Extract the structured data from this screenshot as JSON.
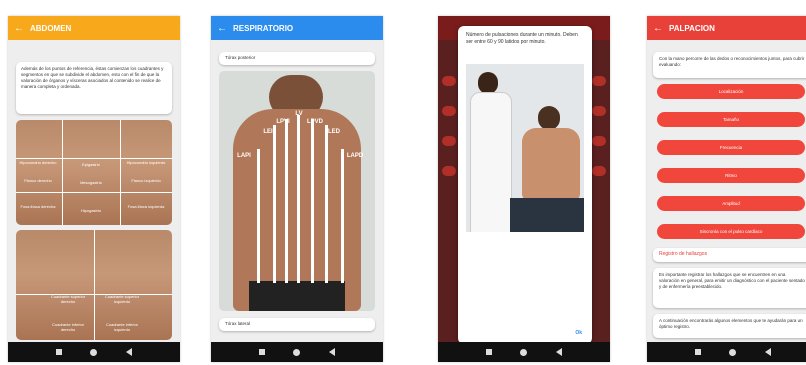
{
  "colors": {
    "orange": "#f7a81b",
    "blue": "#2b8cee",
    "red": "#e8413a",
    "dark_red": "#8b1a1a"
  },
  "screen1": {
    "title": "ABDOMEN",
    "intro": "Además de los puntos de referencia, éstas comienzan los cuadrantes y segmentos en que se subdivide el abdomen, esto con el fin de que la valoración de órganos y vísceras asociados al contenido se realice de manera completa y ordenada.",
    "regions_top": [
      "Hipocondrio derecho",
      "Epigastrio",
      "Hipocondrio izquierdo",
      "Flanco derecho",
      "Mesogastrio",
      "Flanco izquierdo",
      "Fosa ilíaca derecha",
      "Hipogastrio",
      "Fosa ilíaca izquierda"
    ],
    "regions_bottom": [
      "Cuadrante superior derecho",
      "Cuadrante superior izquierdo",
      "Cuadrante inferior derecho",
      "Cuadrante inferior izquierdo"
    ]
  },
  "screen2": {
    "title": "RESPIRATORIO",
    "posterior_label": "Tórax posterior",
    "lines": [
      "LV",
      "LPVI",
      "LPVD",
      "LEI",
      "LED",
      "LAPI",
      "LAPD"
    ],
    "lateral_label": "Tórax lateral"
  },
  "screen3": {
    "dialog_text": "Número de pulsaciones durante un minuto. Deben ser entre 60 y 90 latidos por minuto.",
    "ok_label": "Ok"
  },
  "screen4": {
    "title": "PALPACION",
    "intro": "Con la mano percorre de las dedos o reconocimientos juntos, para cubrir evaluando:",
    "buttons": [
      "Localización",
      "Tamaño",
      "Frecuencia",
      "Ritmo",
      "Amplitud",
      "Sincronía con el pulso cardíaco"
    ],
    "section_title": "Registro de hallazgos",
    "body": "Es importante registrar los hallazgos que se encuentren en una valoración en general, para emitir un diagnóstico con el paciente sentado y de enfermería preestablecido.",
    "footer": "A continuación encontrarás algunos elementos que te ayudarán para un óptimo registro."
  }
}
